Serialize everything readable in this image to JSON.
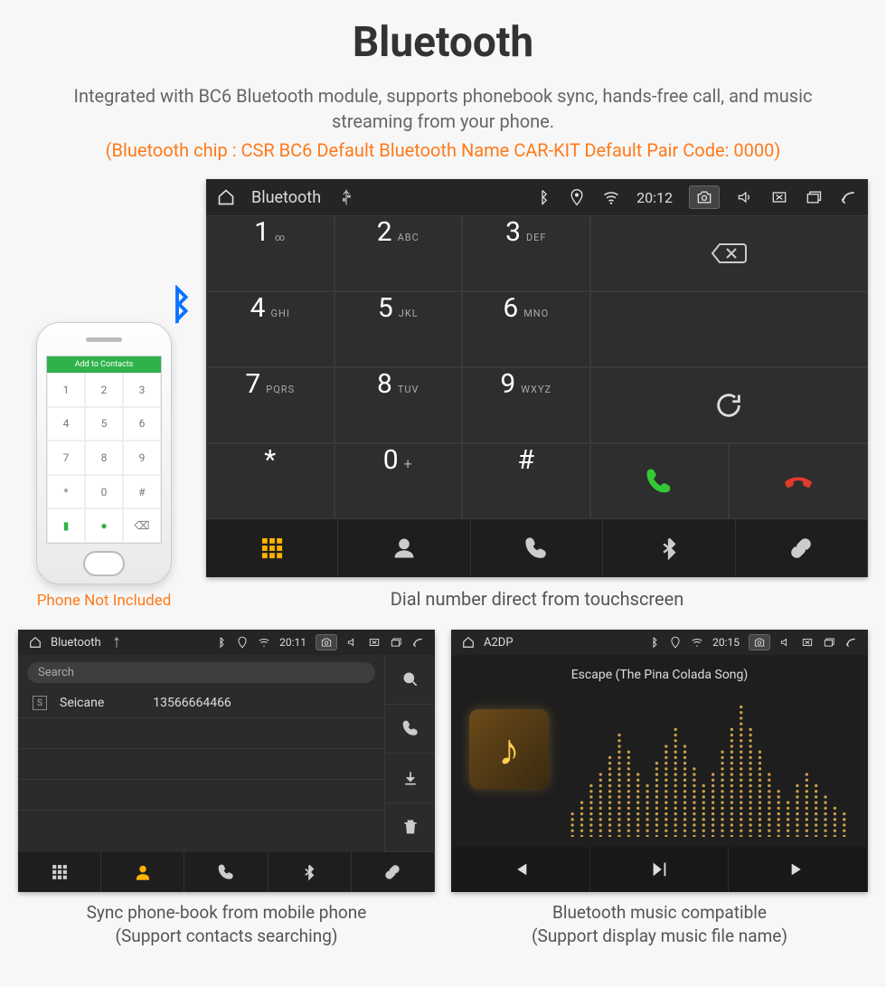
{
  "heading": "Bluetooth",
  "subtitle": "Integrated with BC6 Bluetooth module, supports phonebook sync, hands-free call, and music streaming from your phone.",
  "spec_line": "(Bluetooth chip : CSR BC6     Default Bluetooth Name CAR-KIT     Default Pair Code: 0000)",
  "phone_caption": "Phone Not Included",
  "phone_bar_label": "Add to Contacts",
  "dialer": {
    "status": {
      "title": "Bluetooth",
      "time": "20:12"
    },
    "keys": [
      {
        "num": "1",
        "sub": "∞"
      },
      {
        "num": "2",
        "sub": "ABC"
      },
      {
        "num": "3",
        "sub": "DEF"
      },
      {
        "num": "4",
        "sub": "GHI"
      },
      {
        "num": "5",
        "sub": "JKL"
      },
      {
        "num": "6",
        "sub": "MNO"
      },
      {
        "num": "7",
        "sub": "PQRS"
      },
      {
        "num": "8",
        "sub": "TUV"
      },
      {
        "num": "9",
        "sub": "WXYZ"
      },
      {
        "num": "*",
        "sub": ""
      },
      {
        "num": "0",
        "sub": "+"
      },
      {
        "num": "#",
        "sub": ""
      }
    ],
    "caption": "Dial number direct from touchscreen"
  },
  "phonebook": {
    "status": {
      "title": "Bluetooth",
      "time": "20:11"
    },
    "search_placeholder": "Search",
    "contacts": [
      {
        "badge": "S",
        "name": "Seicane",
        "number": "13566664466"
      }
    ],
    "caption_line1": "Sync phone-book from mobile phone",
    "caption_line2": "(Support contacts searching)"
  },
  "a2dp": {
    "status": {
      "title": "A2DP",
      "time": "20:15"
    },
    "song": "Escape (The Pina Colada Song)",
    "caption_line1": "Bluetooth music compatible",
    "caption_line2": "(Support display music file name)"
  }
}
